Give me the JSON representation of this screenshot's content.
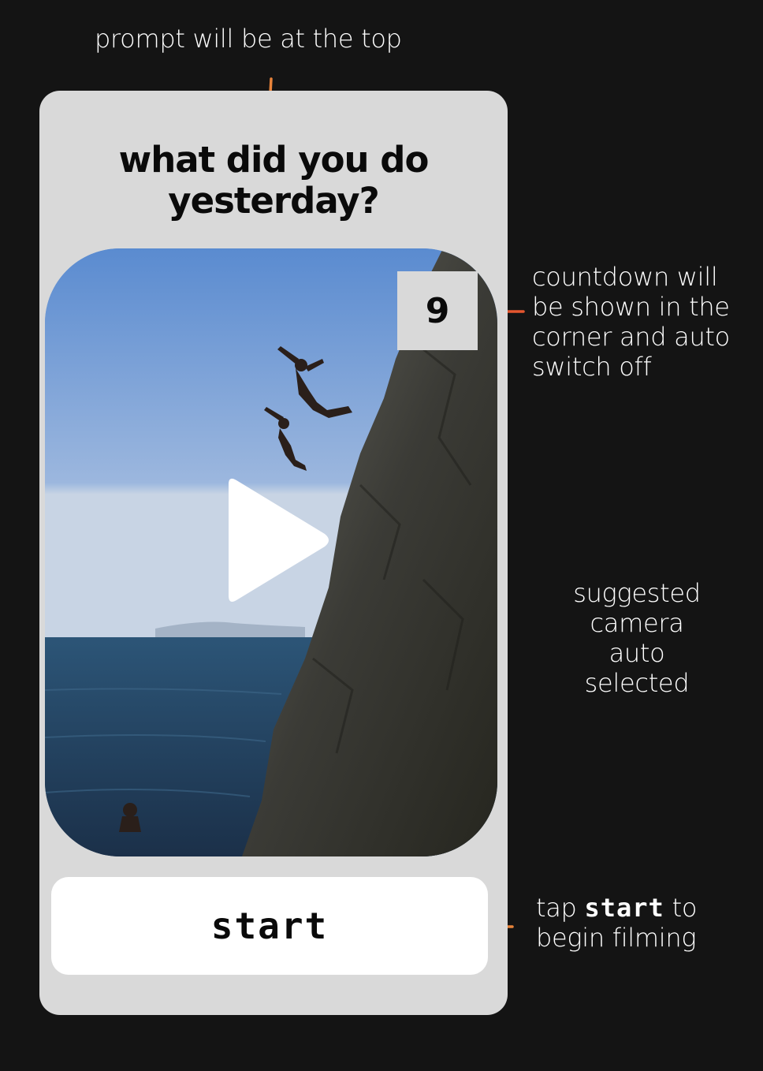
{
  "annotations": {
    "top": "prompt will be at the top",
    "countdown": [
      "countdown will",
      "be shown in the",
      "corner and auto",
      "switch off"
    ],
    "camera": [
      "suggested",
      "camera",
      "auto",
      "selected"
    ],
    "start_before": "tap ",
    "start_keyword": "start",
    "start_after": " to",
    "start_line2": "begin filming"
  },
  "phone": {
    "prompt_line1": "what did you do",
    "prompt_line2": "yesterday?",
    "countdown_value": "9",
    "start_label": "start",
    "play_icon": "play-icon"
  },
  "colors": {
    "background": "#141414",
    "card": "#d9d9d9",
    "arrow": "#e8833a",
    "connector": "#e5562f"
  }
}
